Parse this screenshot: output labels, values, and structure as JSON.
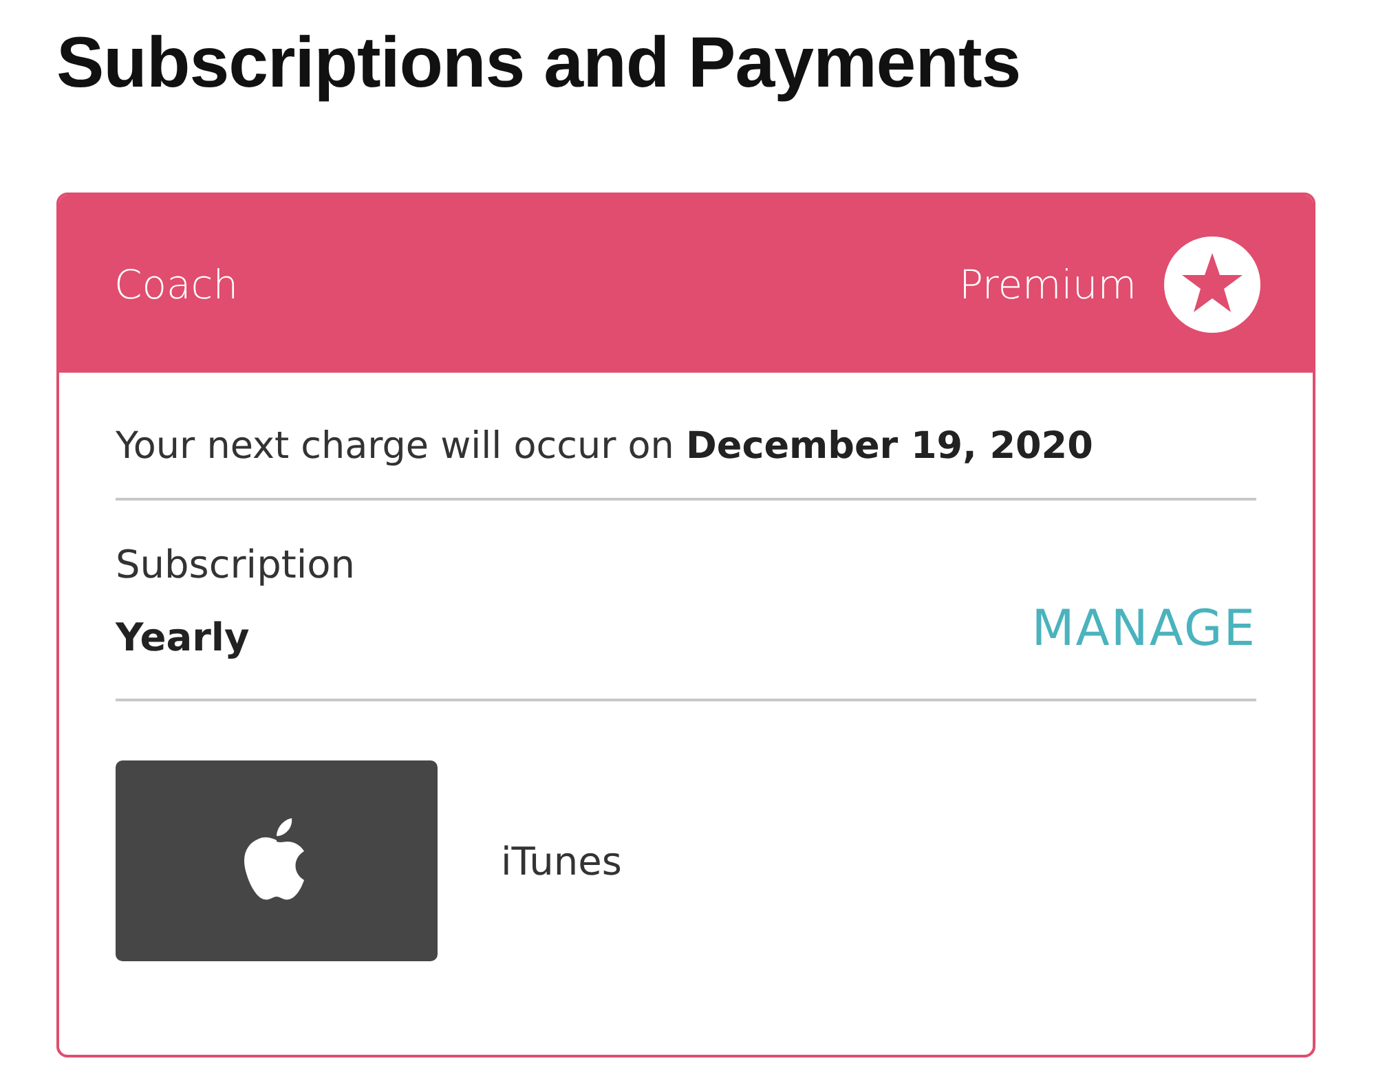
{
  "page_title": "Subscriptions and Payments",
  "plan": {
    "name": "Coach",
    "tier": "Premium"
  },
  "next_charge": "Your next charge will occur on **December 19, 2020**",
  "subscription": {
    "label": "Subscription",
    "value": "Yearly",
    "action": "MANAGE"
  },
  "payment": {
    "method": "iTunes"
  }
}
